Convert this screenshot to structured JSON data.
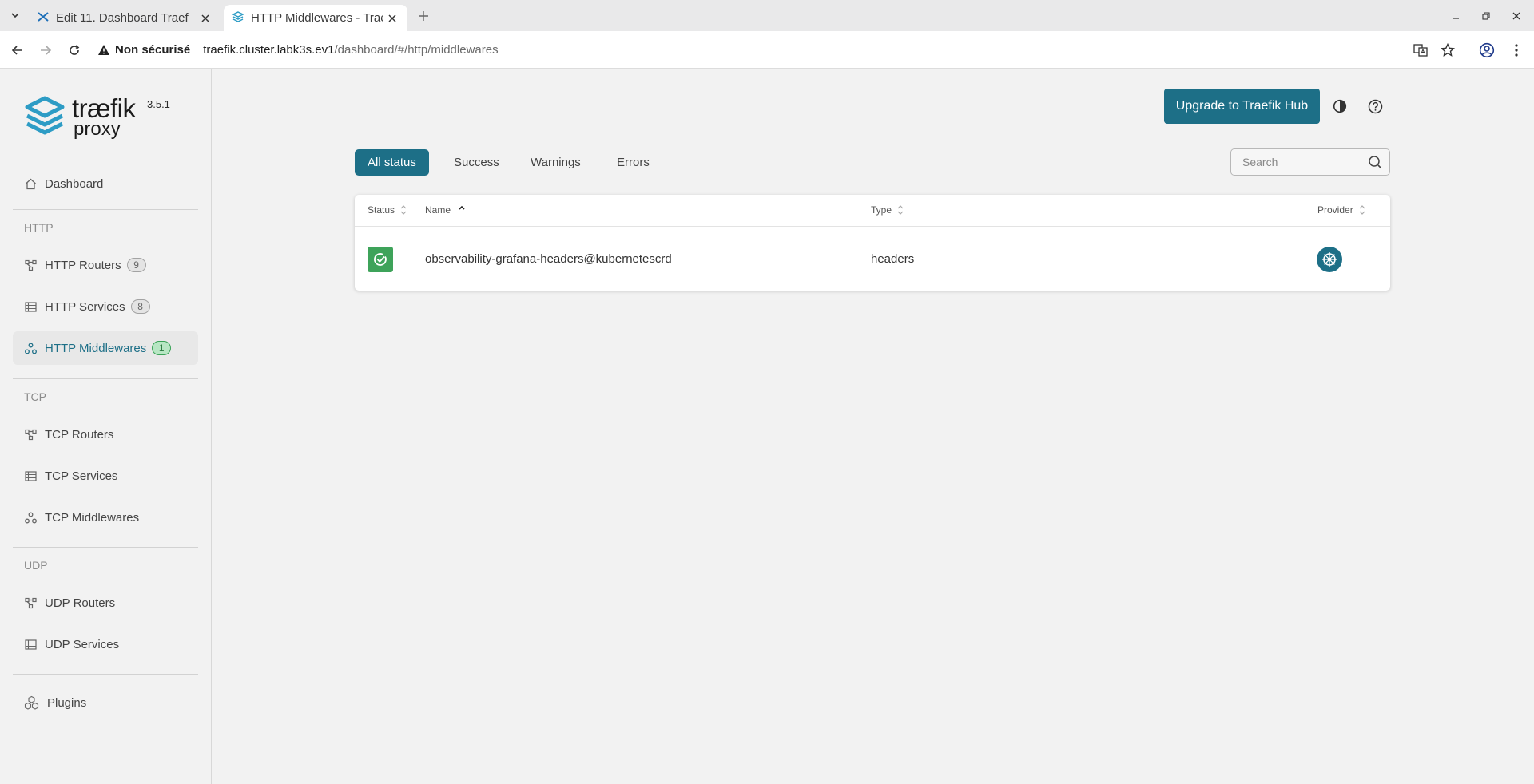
{
  "browser": {
    "tabs": [
      {
        "title": "Edit 11. Dashboard Traef",
        "active": false,
        "icon": "jira-icon"
      },
      {
        "title": "HTTP Middlewares - Trae",
        "active": true,
        "icon": "traefik-icon"
      }
    ],
    "address": {
      "security_label": "Non sécurisé",
      "host": "traefik.cluster.labk3s.ev1",
      "path": "/dashboard/#/http/middlewares"
    }
  },
  "logo": {
    "name": "træfik",
    "sub": "proxy",
    "version": "3.5.1"
  },
  "sidebar": {
    "dashboard": "Dashboard",
    "sections": {
      "http": "HTTP",
      "tcp": "TCP",
      "udp": "UDP"
    },
    "http_routers": {
      "label": "HTTP Routers",
      "count": "9"
    },
    "http_services": {
      "label": "HTTP Services",
      "count": "8"
    },
    "http_middlewares": {
      "label": "HTTP Middlewares",
      "count": "1"
    },
    "tcp_routers": "TCP Routers",
    "tcp_services": "TCP Services",
    "tcp_middlewares": "TCP Middlewares",
    "udp_routers": "UDP Routers",
    "udp_services": "UDP Services",
    "plugins": "Plugins"
  },
  "header": {
    "upgrade_label": "Upgrade to Traefik Hub"
  },
  "filters": {
    "all": "All status",
    "success": "Success",
    "warnings": "Warnings",
    "errors": "Errors"
  },
  "search": {
    "placeholder": "Search"
  },
  "table": {
    "columns": {
      "status": "Status",
      "name": "Name",
      "type": "Type",
      "provider": "Provider"
    },
    "rows": [
      {
        "status": "success",
        "name": "observability-grafana-headers@kubernetescrd",
        "type": "headers",
        "provider": "kubernetes-icon"
      }
    ]
  },
  "colors": {
    "accent": "#1d6f87",
    "success": "#3ea35a"
  }
}
